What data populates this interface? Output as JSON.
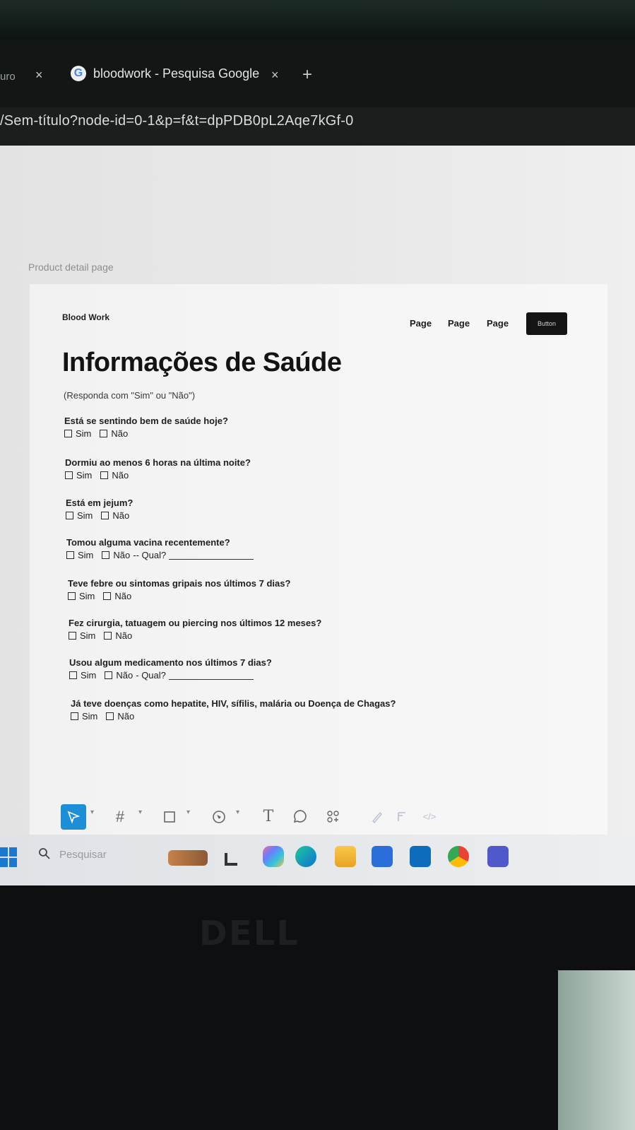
{
  "browser": {
    "prev_tab_partial": "uro",
    "close_glyph": "×",
    "active_tab_title": "bloodwork - Pesquisa Google",
    "new_tab_glyph": "+",
    "url": "/Sem-título?node-id=0-1&p=f&t=dpPDB0pL2Aqe7kGf-0"
  },
  "canvas": {
    "frame_label": "Product detail page"
  },
  "nav": {
    "brand": "Blood Work",
    "links": [
      "Page",
      "Page",
      "Page"
    ],
    "button": "Button"
  },
  "form": {
    "title": "Informações de Saúde",
    "subtitle": "(Responda com \"Sim\" ou \"Não\")",
    "yes": "Sim",
    "no": "Não",
    "questions": [
      {
        "text": "Está se sentindo bem de saúde hoje?",
        "extra": ""
      },
      {
        "text": "Dormiu ao menos 6 horas na última noite?",
        "extra": ""
      },
      {
        "text": "Está em jejum?",
        "extra": ""
      },
      {
        "text": "Tomou alguma vacina recentemente?",
        "extra": "-- Qual?"
      },
      {
        "text": "Teve febre ou sintomas gripais nos últimos 7 dias?",
        "extra": ""
      },
      {
        "text": "Fez cirurgia, tatuagem ou piercing nos últimos 12 meses?",
        "extra": ""
      },
      {
        "text": "Usou algum medicamento nos últimos 7 dias?",
        "extra": "- Qual?"
      },
      {
        "text": "Já teve doenças como hepatite, HIV, sífilis, malária ou Doença de Chagas?",
        "extra": ""
      }
    ]
  },
  "toolbar": {
    "tools": [
      "move-tool",
      "frame-tool",
      "shape-tool",
      "pen-tool",
      "text-tool",
      "comment-tool",
      "resources-tool",
      "draw-tool",
      "dev-mode-tool",
      "code-tool"
    ],
    "text_glyph": "T",
    "frame_glyph": "#",
    "code_glyph": "</>"
  },
  "taskbar": {
    "search_placeholder": "Pesquisar"
  },
  "monitor": {
    "brand": "DELL"
  }
}
